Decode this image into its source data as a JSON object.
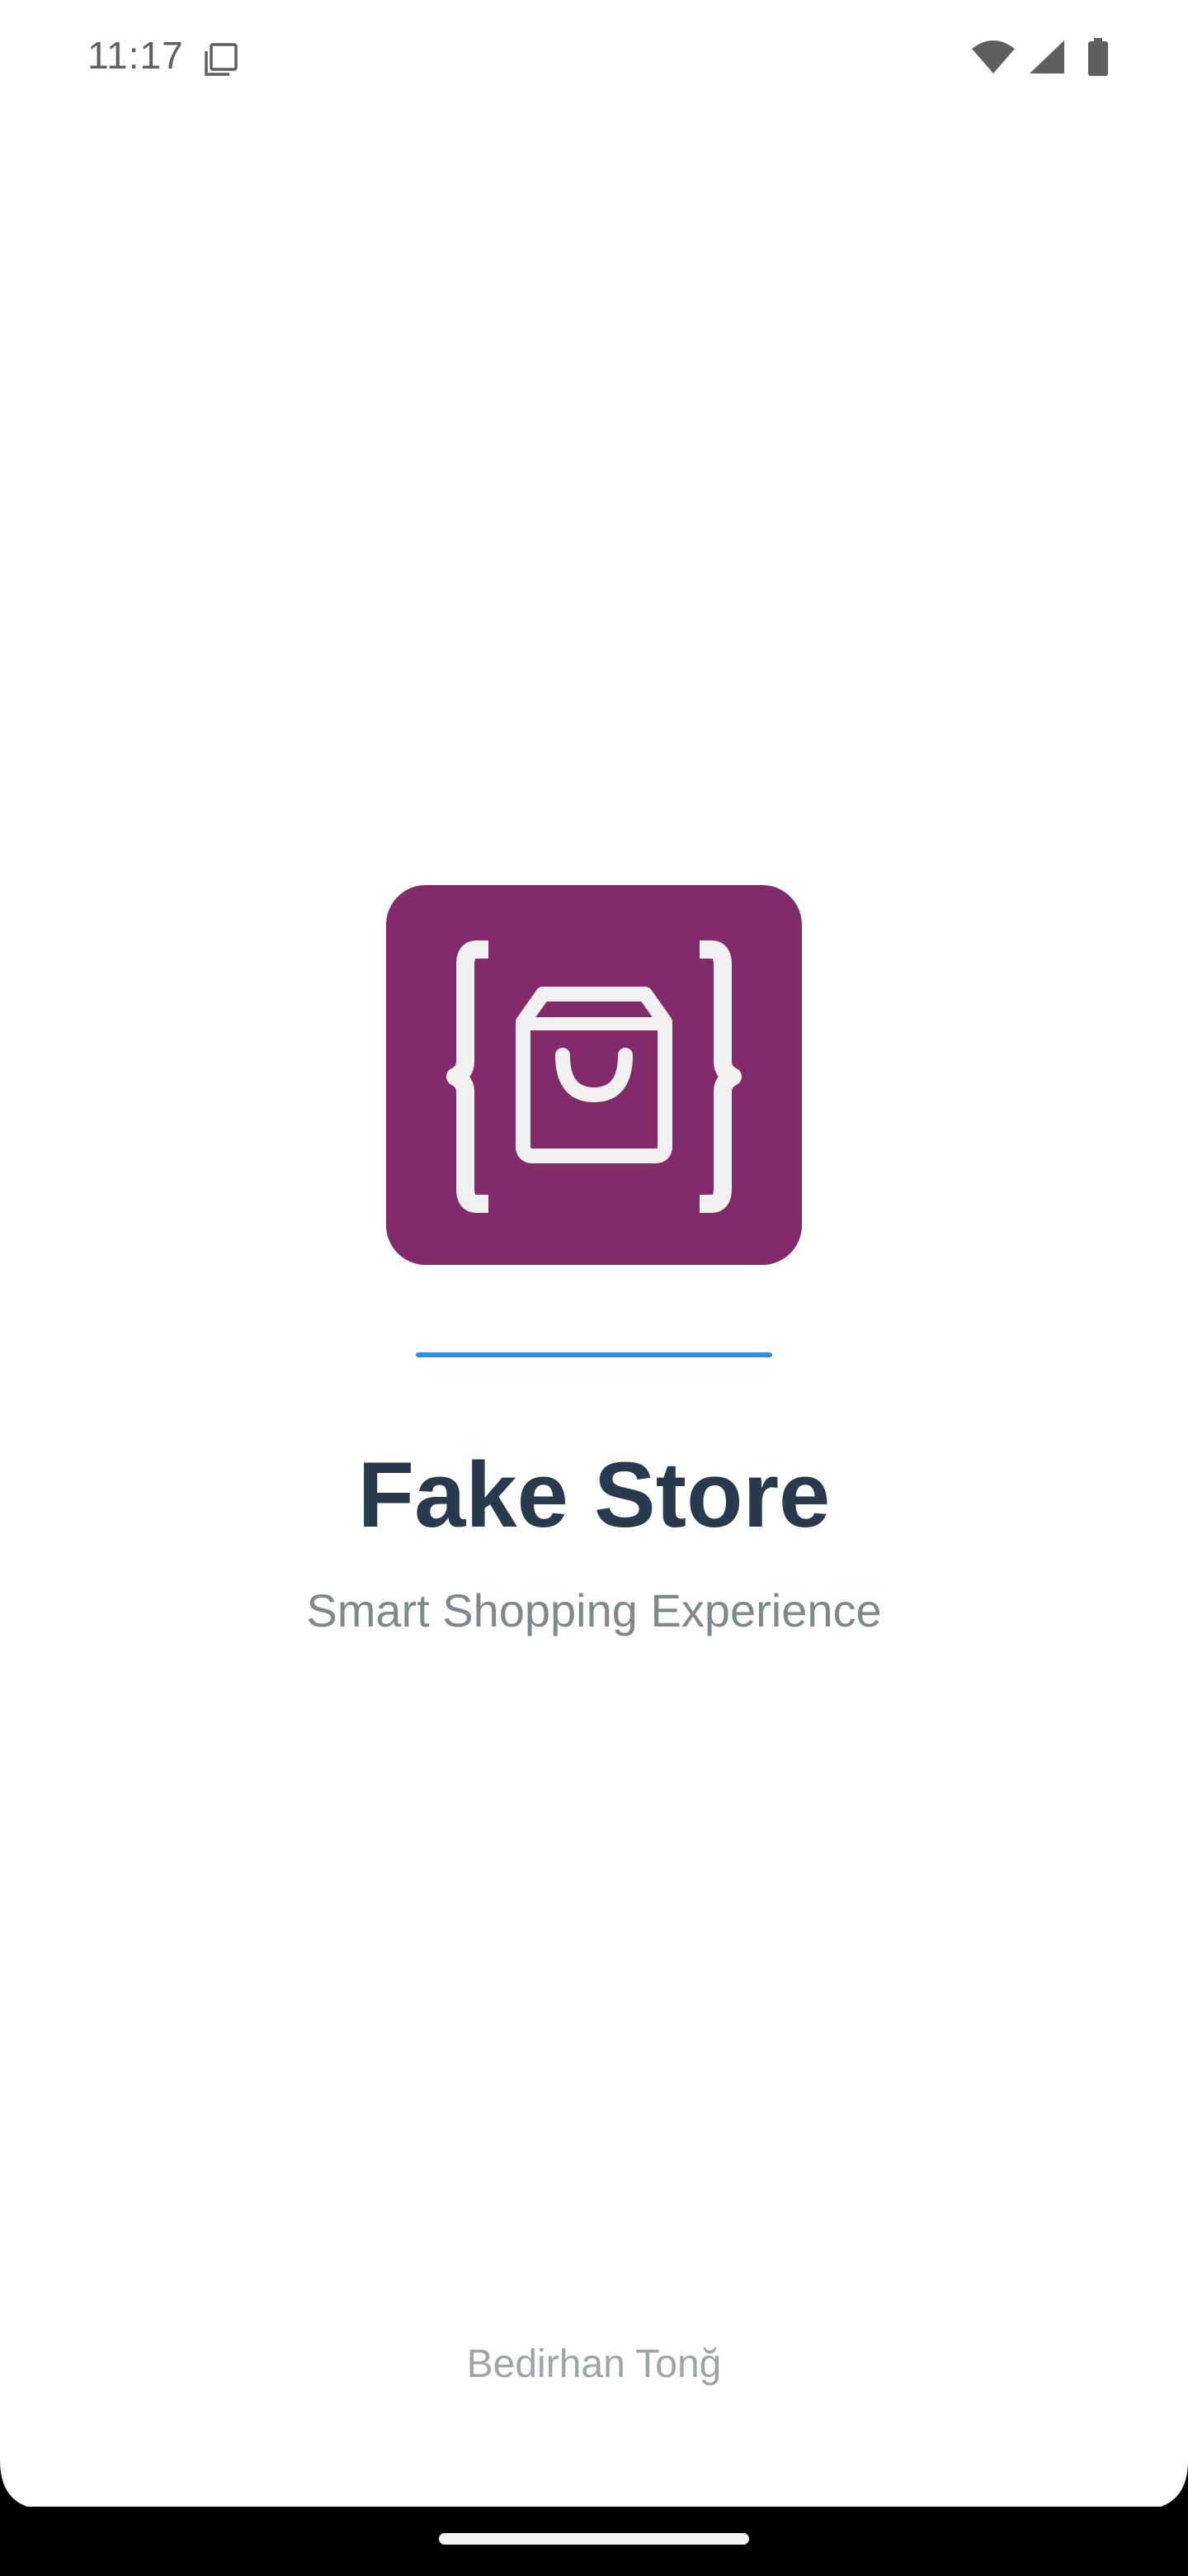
{
  "status_bar": {
    "time": "11:17",
    "icons": [
      "notification-icon",
      "wifi-icon",
      "cellular-signal-icon",
      "battery-icon"
    ],
    "icon_color": "#5f5f5f"
  },
  "splash": {
    "logo_icon": "shopping-bag-icon",
    "logo_bg_color": "#812b6a",
    "accent_color": "#2e8fdc",
    "title": "Fake Store",
    "subtitle": "Smart Shopping Experience",
    "author": "Bedirhan Tonğ"
  },
  "nav_bar": {
    "handle": "home-gesture-handle"
  }
}
